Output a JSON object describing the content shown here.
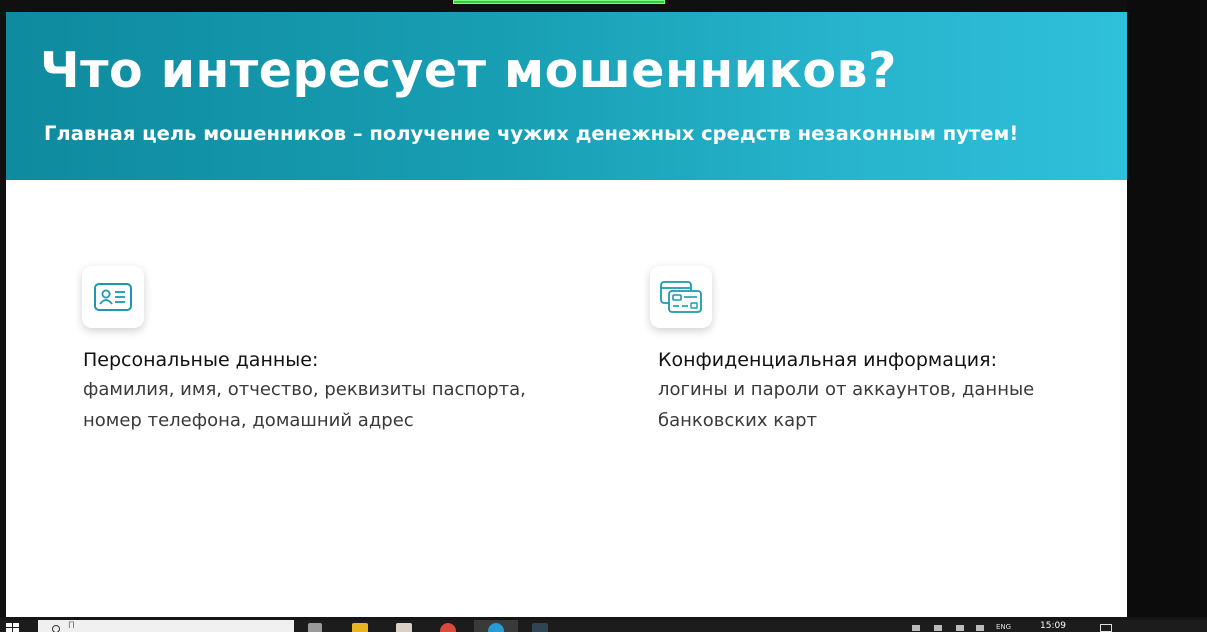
{
  "slide": {
    "title": "Что интересует мошенников?",
    "subtitle": "Главная цель мошенников – получение чужих денежных средств незаконным путем!",
    "blocks": [
      {
        "icon": "id-card-icon",
        "title": "Персональные данные:",
        "lines": [
          "фамилия, имя, отчество, реквизиты паспорта,",
          "номер телефона, домашний адрес"
        ]
      },
      {
        "icon": "bank-cards-icon",
        "title": "Конфиденциальная информация:",
        "lines": [
          "логины и пароли от аккаунтов, данные",
          "банковских карт"
        ]
      }
    ],
    "colors": {
      "header_gradient_start": "#0f8a9e",
      "header_gradient_end": "#2fc0da",
      "icon_accent": "#1a9aab"
    }
  },
  "taskbar": {
    "search_placeholder": "П",
    "language": "ENG",
    "clock": "15:09",
    "apps": [
      "task-view-icon",
      "file-explorer-icon",
      "paint-icon",
      "chrome-icon",
      "edge-icon",
      "app-icon"
    ]
  }
}
